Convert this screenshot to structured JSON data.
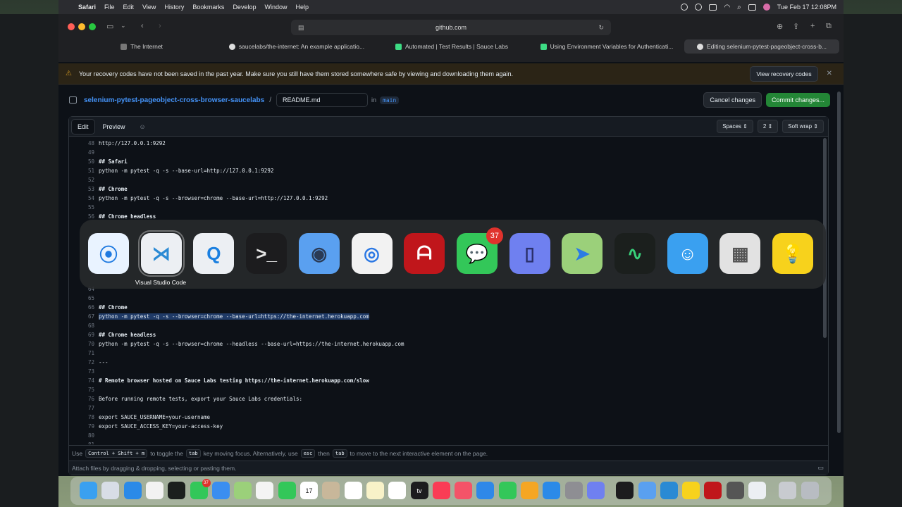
{
  "menubar": {
    "apple": "",
    "app_name": "Safari",
    "menus": [
      "File",
      "Edit",
      "View",
      "History",
      "Bookmarks",
      "Develop",
      "Window",
      "Help"
    ],
    "clock": "Tue Feb 17  12:08PM"
  },
  "safari": {
    "address": "github.com",
    "tabs": [
      {
        "label": "The Internet",
        "favicon_color": "#777777"
      },
      {
        "label": "saucelabs/the-internet: An example applicatio...",
        "favicon_color": "#dddddd"
      },
      {
        "label": "Automated | Test Results | Sauce Labs",
        "favicon_color": "#3ddc84"
      },
      {
        "label": "Using Environment Variables for Authenticati...",
        "favicon_color": "#3ddc84"
      },
      {
        "label": "Editing selenium-pytest-pageobject-cross-b...",
        "favicon_color": "#dddddd"
      }
    ]
  },
  "banner": {
    "icon": "alert-icon",
    "text": "Your recovery codes have not been saved in the past year. Make sure you still have them stored somewhere safe by viewing and downloading them again.",
    "button": "View recovery codes",
    "close": "✕"
  },
  "editor_header": {
    "repo": "selenium-pytest-pageobject-cross-browser-saucelabs",
    "separator": "/",
    "filename": "README.md",
    "in_label": "in",
    "branch": "main",
    "cancel": "Cancel changes",
    "commit": "Commit changes..."
  },
  "editor": {
    "tab_edit": "Edit",
    "tab_preview": "Preview",
    "indent_mode": "Spaces",
    "indent_size": "2",
    "wrap_mode": "Soft wrap",
    "lines": [
      {
        "n": "48",
        "text": "http://127.0.0.1:9292",
        "style": "normal"
      },
      {
        "n": "49",
        "text": "",
        "style": "normal"
      },
      {
        "n": "50",
        "text": "## Safari",
        "style": "bold"
      },
      {
        "n": "51",
        "text": "python -m pytest -q -s --base-url=http://127.0.0.1:9292",
        "style": "normal"
      },
      {
        "n": "52",
        "text": "",
        "style": "normal"
      },
      {
        "n": "53",
        "text": "## Chrome",
        "style": "bold"
      },
      {
        "n": "54",
        "text": "python -m pytest -q -s --browser=chrome --base-url=http://127.0.0.1:9292",
        "style": "normal"
      },
      {
        "n": "55",
        "text": "",
        "style": "normal"
      },
      {
        "n": "56",
        "text": "## Chrome headless",
        "style": "bold"
      },
      {
        "n": "64",
        "text": "",
        "style": "normal"
      },
      {
        "n": "65",
        "text": "",
        "style": "normal"
      },
      {
        "n": "66",
        "text": "## Chrome",
        "style": "bold"
      },
      {
        "n": "67",
        "text": "python -m pytest -q -s --browser=chrome --base-url=https://the-internet.herokuapp.com",
        "style": "highlight"
      },
      {
        "n": "68",
        "text": "",
        "style": "normal"
      },
      {
        "n": "69",
        "text": "## Chrome headless",
        "style": "bold"
      },
      {
        "n": "70",
        "text": "python -m pytest -q -s --browser=chrome --headless --base-url=https://the-internet.herokuapp.com",
        "style": "normal"
      },
      {
        "n": "71",
        "text": "",
        "style": "normal"
      },
      {
        "n": "72",
        "text": "---",
        "style": "normal"
      },
      {
        "n": "73",
        "text": "",
        "style": "normal"
      },
      {
        "n": "74",
        "text": "# Remote browser hosted on Sauce Labs testing https://the-internet.herokuapp.com/slow",
        "style": "bold"
      },
      {
        "n": "75",
        "text": "",
        "style": "normal"
      },
      {
        "n": "76",
        "text": "Before running remote tests, export your Sauce Labs credentials:",
        "style": "normal"
      },
      {
        "n": "77",
        "text": "",
        "style": "normal"
      },
      {
        "n": "78",
        "text": "export SAUCE_USERNAME=your-username",
        "style": "normal"
      },
      {
        "n": "79",
        "text": "export SAUCE_ACCESS_KEY=your-access-key",
        "style": "normal"
      },
      {
        "n": "80",
        "text": "",
        "style": "normal"
      },
      {
        "n": "81",
        "text": "---",
        "style": "normal"
      }
    ],
    "footer_hint": {
      "use": "Use",
      "keys1": "Control + Shift + m",
      "t1": "to toggle the",
      "key_tab": "tab",
      "t2": "key moving focus. Alternatively, use",
      "key_esc": "esc",
      "t3": "then",
      "key_tab2": "tab",
      "t4": "to move to the next interactive element on the page."
    },
    "attach_text": "Attach files by dragging & dropping, selecting or pasting them."
  },
  "switcher": {
    "selected_label": "Visual Studio Code",
    "apps": [
      {
        "name": "safari-app-icon",
        "glyph": "⦿",
        "bg": "#e9f3ff",
        "fg": "#1f7ae0"
      },
      {
        "name": "vscode-app-icon",
        "glyph": "⋊",
        "bg": "#eceff3",
        "fg": "#2a8ad4"
      },
      {
        "name": "quicktime-app-icon",
        "glyph": "Q",
        "bg": "#eceff3",
        "fg": "#1a7fe0"
      },
      {
        "name": "terminal-app-icon",
        "glyph": ">_",
        "bg": "#1c1c1e",
        "fg": "#e6e6e6"
      },
      {
        "name": "preview-app-icon",
        "glyph": "◉",
        "bg": "#5aa0f0",
        "fg": "#2a3a55"
      },
      {
        "name": "chrome-app-icon",
        "glyph": "◎",
        "bg": "#f2f2f2",
        "fg": "#2b78e4"
      },
      {
        "name": "acrobat-app-icon",
        "glyph": "ᗩ",
        "bg": "#c0161b",
        "fg": "#ffffff"
      },
      {
        "name": "messages-app-icon",
        "glyph": "💬",
        "bg": "#33c759",
        "fg": "#ffffff",
        "badge": "37"
      },
      {
        "name": "simulator-app-icon",
        "glyph": "▯",
        "bg": "#6f80f0",
        "fg": "#2a2f6a"
      },
      {
        "name": "maps-app-icon",
        "glyph": "➤",
        "bg": "#9bd07a",
        "fg": "#2b7be4"
      },
      {
        "name": "activity-monitor-app-icon",
        "glyph": "∿",
        "bg": "#1b1f1d",
        "fg": "#38d07a"
      },
      {
        "name": "finder-app-icon",
        "glyph": "☺",
        "bg": "#3aa0f0",
        "fg": "#ffffff"
      },
      {
        "name": "calculator-app-icon",
        "glyph": "▦",
        "bg": "#e2e2e2",
        "fg": "#555555"
      },
      {
        "name": "tips-app-icon",
        "glyph": "💡",
        "bg": "#f7d21c",
        "fg": "#b08a00"
      }
    ]
  },
  "dock": {
    "items": [
      {
        "name": "finder-dock-icon",
        "bg": "#3aa0f0"
      },
      {
        "name": "launchpad-dock-icon",
        "bg": "#d8dde6"
      },
      {
        "name": "safari-dock-icon",
        "bg": "#2b8ae8"
      },
      {
        "name": "chrome-dock-icon",
        "bg": "#f2f2f2"
      },
      {
        "name": "activity-dock-icon",
        "bg": "#1b1f1d"
      },
      {
        "name": "messages-dock-icon",
        "bg": "#33c759",
        "badge": "37"
      },
      {
        "name": "mail-dock-icon",
        "bg": "#3a8ef0"
      },
      {
        "name": "maps-dock-icon",
        "bg": "#9bd07a"
      },
      {
        "name": "photos-dock-icon",
        "bg": "#f4f4f4"
      },
      {
        "name": "facetime-dock-icon",
        "bg": "#33c759"
      },
      {
        "name": "calendar-dock-icon",
        "bg": "#ffffff",
        "label": "17"
      },
      {
        "name": "contacts-dock-icon",
        "bg": "#c8b79a"
      },
      {
        "name": "reminders-dock-icon",
        "bg": "#ffffff"
      },
      {
        "name": "notes-dock-icon",
        "bg": "#f8f2c8"
      },
      {
        "name": "freeform-dock-icon",
        "bg": "#ffffff"
      },
      {
        "name": "tv-dock-icon",
        "bg": "#1c1c1e",
        "label": "tv"
      },
      {
        "name": "music-dock-icon",
        "bg": "#fa3c55"
      },
      {
        "name": "news-dock-icon",
        "bg": "#f45368"
      },
      {
        "name": "keynote-dock-icon",
        "bg": "#2f88e8"
      },
      {
        "name": "numbers-dock-icon",
        "bg": "#33c759"
      },
      {
        "name": "pages-dock-icon",
        "bg": "#f5a623"
      },
      {
        "name": "appstore-dock-icon",
        "bg": "#2b8ae8"
      },
      {
        "name": "settings-dock-icon",
        "bg": "#8e8e93"
      },
      {
        "name": "simulator-dock-icon",
        "bg": "#6f80f0"
      },
      {
        "name": "terminal-dock-icon",
        "bg": "#1c1c1e"
      },
      {
        "name": "preview-dock-icon",
        "bg": "#5aa0f0"
      },
      {
        "name": "vscode-dock-icon",
        "bg": "#2a8ad4"
      },
      {
        "name": "tips-dock-icon",
        "bg": "#f7d21c"
      },
      {
        "name": "acrobat-dock-icon",
        "bg": "#c0161b"
      },
      {
        "name": "calculator-dock-icon",
        "bg": "#555555"
      },
      {
        "name": "quicktime-dock-icon",
        "bg": "#eceff3"
      },
      {
        "name": "downloads-dock-icon",
        "bg": "#c8cbd0"
      },
      {
        "name": "trash-dock-icon",
        "bg": "#b8bcc2"
      }
    ]
  }
}
